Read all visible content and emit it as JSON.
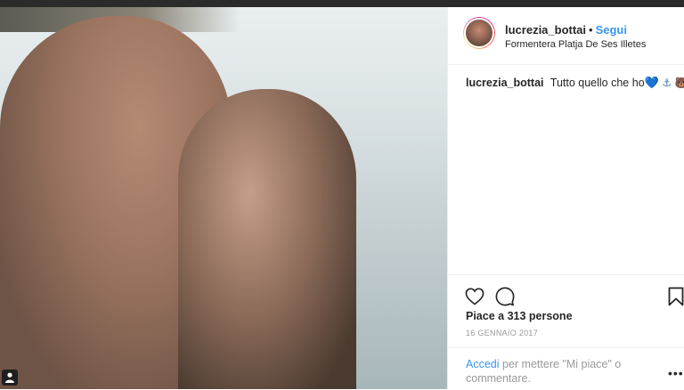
{
  "post": {
    "username": "lucrezia_bottai",
    "separator": "•",
    "follow_label": "Segui",
    "location": "Formentera Platja De Ses Illetes",
    "caption_username": "lucrezia_bottai",
    "caption_text": "Tutto quello che ho",
    "caption_emojis": {
      "heart": "💙",
      "anchor": "⚓",
      "bear": "🐻"
    },
    "likes_text": "Piace a 313 persone",
    "date": "16 GENNAIO 2017",
    "login_link": "Accedi",
    "login_text": "per mettere \"Mi piace\" o commentare.",
    "more_label": "•••"
  },
  "icons": {
    "tagged_user": "user-icon",
    "like": "heart-icon",
    "comment": "comment-icon",
    "save": "bookmark-icon"
  },
  "colors": {
    "link": "#3897f0",
    "text": "#262626",
    "muted": "#999999",
    "divider": "#efefef"
  }
}
